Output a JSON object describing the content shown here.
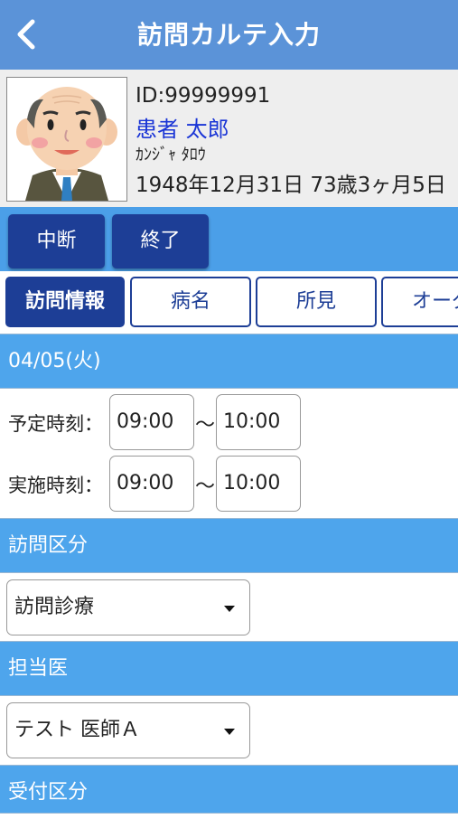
{
  "nav": {
    "title": "訪問カルテ入力"
  },
  "patient": {
    "id": "ID:99999991",
    "name": "患者 太郎",
    "kana": "ｶﾝｼﾞｬ ﾀﾛｳ",
    "birth": "1948年12月31日 73歳3ヶ月5日"
  },
  "actions": {
    "pause": "中断",
    "finish": "終了"
  },
  "tabs": [
    "訪問情報",
    "病名",
    "所見",
    "オーダ"
  ],
  "visit": {
    "date": "04/05(火)",
    "planned_label": "予定時刻：",
    "planned_start": "09:00",
    "planned_end": "10:00",
    "actual_label": "実施時刻：",
    "actual_start": "09:00",
    "actual_end": "10:00",
    "tilde": "〜"
  },
  "sections": {
    "visit_type": "訪問区分",
    "doctor": "担当医",
    "reception": "受付区分"
  },
  "selects": {
    "visit_type": "訪問診療",
    "doctor": "テスト 医師Ａ"
  },
  "colors": {
    "navbar": "#5b93d8",
    "section": "#4ea5ec",
    "button": "#1d3e96",
    "patient_name": "#1a35d6"
  }
}
